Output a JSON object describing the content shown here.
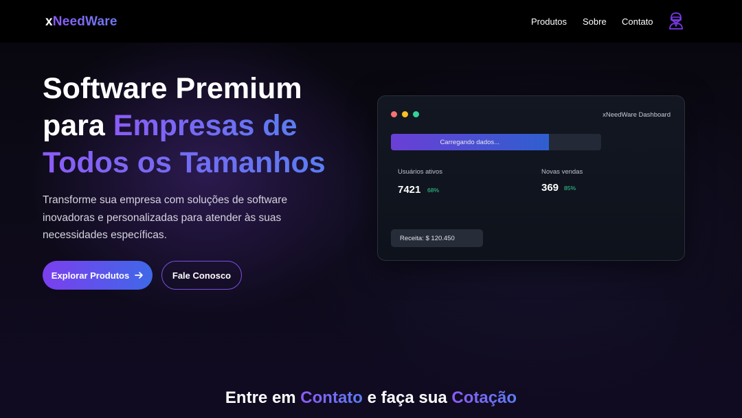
{
  "brand": {
    "logo_prefix": "x",
    "logo_rest": "NeedWare"
  },
  "nav": {
    "items": [
      "Produtos",
      "Sobre",
      "Contato"
    ],
    "avatar_icon": "user-hacker-icon"
  },
  "hero": {
    "title_line1": "Software Premium",
    "title_line2_plain": "para ",
    "title_line2_grad": "Empresas de",
    "title_line3_grad": "Todos os Tamanhos",
    "description": "Transforme sua empresa com soluções de software inovadoras e personalizadas para atender às suas necessidades específicas.",
    "primary_button": "Explorar Produtos",
    "primary_button_icon": "arrow-right-icon",
    "secondary_button": "Fale Conosco"
  },
  "dashboard": {
    "title": "xNeedWare Dashboard",
    "window_dots": [
      "#f87171",
      "#fbbf24",
      "#34d399"
    ],
    "progress_label": "Carregando dados...",
    "progress_fraction": 0.75,
    "stats": [
      {
        "label": "Usuários ativos",
        "value": "7421",
        "percent": "68%"
      },
      {
        "label": "Novas vendas",
        "value": "369",
        "percent": "85%"
      }
    ],
    "revenue": "Receita: $ 120.450"
  },
  "contact": {
    "part1": "Entre em ",
    "part2": "Contato",
    "part3": " e faça sua ",
    "part4": "Cotação"
  },
  "colors": {
    "accent_purple": "#8b5cf6",
    "accent_blue": "#5b7cf2",
    "success": "#34d399"
  }
}
